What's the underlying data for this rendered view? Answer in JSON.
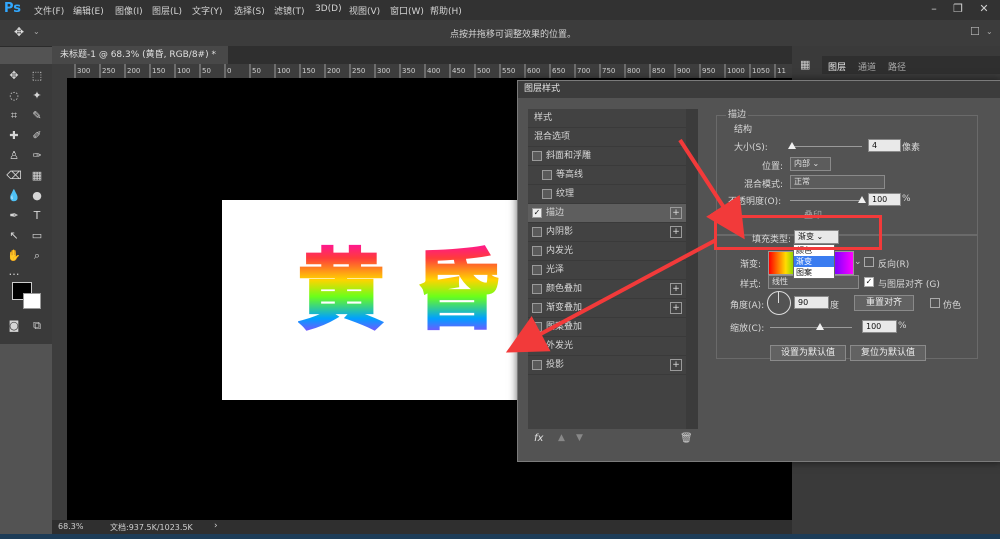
{
  "app": {
    "logo": "Ps"
  },
  "menu": [
    "文件(F)",
    "编辑(E)",
    "图像(I)",
    "图层(L)",
    "文字(Y)",
    "选择(S)",
    "滤镜(T)",
    "3D(D)",
    "视图(V)",
    "窗口(W)",
    "帮助(H)"
  ],
  "options_bar": {
    "hint": "点按并拖移可调整效果的位置。"
  },
  "document": {
    "tab_title": "未标题-1 @ 68.3% (黄昏, RGB/8#) *",
    "text_content": "黄 昏",
    "ruler_labels": [
      "300",
      "250",
      "200",
      "150",
      "100",
      "50",
      "0",
      "50",
      "100",
      "150",
      "200",
      "250",
      "300",
      "350",
      "400",
      "450",
      "500",
      "550",
      "600",
      "650",
      "700",
      "750",
      "800",
      "850",
      "900",
      "950",
      "1000",
      "1050",
      "11"
    ]
  },
  "status": {
    "zoom": "68.3%",
    "doc_info": "文档:937.5K/1023.5K",
    "arrow": "›"
  },
  "panels": {
    "tabs": [
      "图层",
      "通道",
      "路径"
    ]
  },
  "dialog": {
    "title": "图层样式",
    "list": [
      {
        "label": "样式",
        "check": false,
        "checkbox": false,
        "plus": false,
        "indent": 0,
        "header": true
      },
      {
        "label": "混合选项",
        "check": false,
        "checkbox": false,
        "plus": false,
        "indent": 0,
        "header": true
      },
      {
        "label": "斜面和浮雕",
        "check": false,
        "checkbox": true,
        "plus": false,
        "indent": 0
      },
      {
        "label": "等高线",
        "check": false,
        "checkbox": true,
        "plus": false,
        "indent": 1
      },
      {
        "label": "纹理",
        "check": false,
        "checkbox": true,
        "plus": false,
        "indent": 1
      },
      {
        "label": "描边",
        "check": true,
        "checkbox": true,
        "plus": true,
        "indent": 0,
        "selected": true
      },
      {
        "label": "内阴影",
        "check": false,
        "checkbox": true,
        "plus": true,
        "indent": 0
      },
      {
        "label": "内发光",
        "check": false,
        "checkbox": true,
        "plus": false,
        "indent": 0
      },
      {
        "label": "光泽",
        "check": false,
        "checkbox": true,
        "plus": false,
        "indent": 0
      },
      {
        "label": "颜色叠加",
        "check": false,
        "checkbox": true,
        "plus": true,
        "indent": 0
      },
      {
        "label": "渐变叠加",
        "check": false,
        "checkbox": true,
        "plus": true,
        "indent": 0
      },
      {
        "label": "图案叠加",
        "check": false,
        "checkbox": true,
        "plus": false,
        "indent": 0
      },
      {
        "label": "外发光",
        "check": false,
        "checkbox": true,
        "plus": false,
        "indent": 0
      },
      {
        "label": "投影",
        "check": false,
        "checkbox": true,
        "plus": true,
        "indent": 0
      }
    ],
    "footer_fx": "fx",
    "section_title": "描边",
    "group_title": "结构",
    "size_label": "大小(S):",
    "size_value": "4",
    "size_unit": "像素",
    "position_label": "位置:",
    "position_value": "内部",
    "blend_label": "混合模式:",
    "blend_value": "正常",
    "opacity_label": "不透明度(O):",
    "opacity_value": "100",
    "opacity_unit": "%",
    "overprint_label": "叠印",
    "fill_type_label": "填充类型:",
    "fill_type_value": "渐变",
    "fill_type_options": [
      "颜色",
      "渐变",
      "图案"
    ],
    "gradient_label": "渐变:",
    "reverse_label": "反向(R)",
    "style_label": "样式:",
    "style_value": "线性",
    "align_label": "与图层对齐 (G)",
    "angle_label": "角度(A):",
    "angle_value": "90",
    "angle_unit": "度",
    "reset_align": "重置对齐",
    "dither_label": "仿色",
    "scale_label": "缩放(C):",
    "scale_value": "100",
    "scale_unit": "%",
    "set_default": "设置为默认值",
    "reset_default": "复位为默认值"
  }
}
